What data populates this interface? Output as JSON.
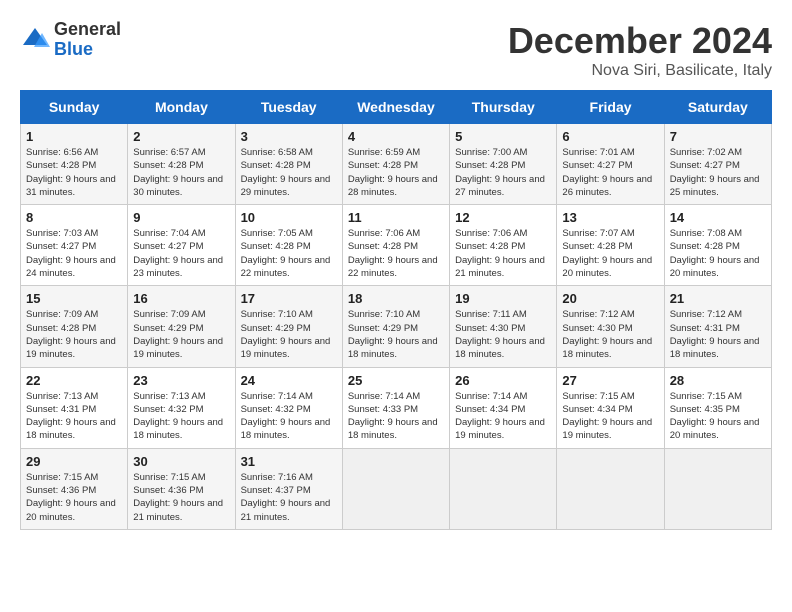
{
  "logo": {
    "general": "General",
    "blue": "Blue"
  },
  "header": {
    "month": "December 2024",
    "location": "Nova Siri, Basilicate, Italy"
  },
  "days_of_week": [
    "Sunday",
    "Monday",
    "Tuesday",
    "Wednesday",
    "Thursday",
    "Friday",
    "Saturday"
  ],
  "weeks": [
    [
      {
        "day": "1",
        "sunrise": "Sunrise: 6:56 AM",
        "sunset": "Sunset: 4:28 PM",
        "daylight": "Daylight: 9 hours and 31 minutes."
      },
      {
        "day": "2",
        "sunrise": "Sunrise: 6:57 AM",
        "sunset": "Sunset: 4:28 PM",
        "daylight": "Daylight: 9 hours and 30 minutes."
      },
      {
        "day": "3",
        "sunrise": "Sunrise: 6:58 AM",
        "sunset": "Sunset: 4:28 PM",
        "daylight": "Daylight: 9 hours and 29 minutes."
      },
      {
        "day": "4",
        "sunrise": "Sunrise: 6:59 AM",
        "sunset": "Sunset: 4:28 PM",
        "daylight": "Daylight: 9 hours and 28 minutes."
      },
      {
        "day": "5",
        "sunrise": "Sunrise: 7:00 AM",
        "sunset": "Sunset: 4:28 PM",
        "daylight": "Daylight: 9 hours and 27 minutes."
      },
      {
        "day": "6",
        "sunrise": "Sunrise: 7:01 AM",
        "sunset": "Sunset: 4:27 PM",
        "daylight": "Daylight: 9 hours and 26 minutes."
      },
      {
        "day": "7",
        "sunrise": "Sunrise: 7:02 AM",
        "sunset": "Sunset: 4:27 PM",
        "daylight": "Daylight: 9 hours and 25 minutes."
      }
    ],
    [
      {
        "day": "8",
        "sunrise": "Sunrise: 7:03 AM",
        "sunset": "Sunset: 4:27 PM",
        "daylight": "Daylight: 9 hours and 24 minutes."
      },
      {
        "day": "9",
        "sunrise": "Sunrise: 7:04 AM",
        "sunset": "Sunset: 4:27 PM",
        "daylight": "Daylight: 9 hours and 23 minutes."
      },
      {
        "day": "10",
        "sunrise": "Sunrise: 7:05 AM",
        "sunset": "Sunset: 4:28 PM",
        "daylight": "Daylight: 9 hours and 22 minutes."
      },
      {
        "day": "11",
        "sunrise": "Sunrise: 7:06 AM",
        "sunset": "Sunset: 4:28 PM",
        "daylight": "Daylight: 9 hours and 22 minutes."
      },
      {
        "day": "12",
        "sunrise": "Sunrise: 7:06 AM",
        "sunset": "Sunset: 4:28 PM",
        "daylight": "Daylight: 9 hours and 21 minutes."
      },
      {
        "day": "13",
        "sunrise": "Sunrise: 7:07 AM",
        "sunset": "Sunset: 4:28 PM",
        "daylight": "Daylight: 9 hours and 20 minutes."
      },
      {
        "day": "14",
        "sunrise": "Sunrise: 7:08 AM",
        "sunset": "Sunset: 4:28 PM",
        "daylight": "Daylight: 9 hours and 20 minutes."
      }
    ],
    [
      {
        "day": "15",
        "sunrise": "Sunrise: 7:09 AM",
        "sunset": "Sunset: 4:28 PM",
        "daylight": "Daylight: 9 hours and 19 minutes."
      },
      {
        "day": "16",
        "sunrise": "Sunrise: 7:09 AM",
        "sunset": "Sunset: 4:29 PM",
        "daylight": "Daylight: 9 hours and 19 minutes."
      },
      {
        "day": "17",
        "sunrise": "Sunrise: 7:10 AM",
        "sunset": "Sunset: 4:29 PM",
        "daylight": "Daylight: 9 hours and 19 minutes."
      },
      {
        "day": "18",
        "sunrise": "Sunrise: 7:10 AM",
        "sunset": "Sunset: 4:29 PM",
        "daylight": "Daylight: 9 hours and 18 minutes."
      },
      {
        "day": "19",
        "sunrise": "Sunrise: 7:11 AM",
        "sunset": "Sunset: 4:30 PM",
        "daylight": "Daylight: 9 hours and 18 minutes."
      },
      {
        "day": "20",
        "sunrise": "Sunrise: 7:12 AM",
        "sunset": "Sunset: 4:30 PM",
        "daylight": "Daylight: 9 hours and 18 minutes."
      },
      {
        "day": "21",
        "sunrise": "Sunrise: 7:12 AM",
        "sunset": "Sunset: 4:31 PM",
        "daylight": "Daylight: 9 hours and 18 minutes."
      }
    ],
    [
      {
        "day": "22",
        "sunrise": "Sunrise: 7:13 AM",
        "sunset": "Sunset: 4:31 PM",
        "daylight": "Daylight: 9 hours and 18 minutes."
      },
      {
        "day": "23",
        "sunrise": "Sunrise: 7:13 AM",
        "sunset": "Sunset: 4:32 PM",
        "daylight": "Daylight: 9 hours and 18 minutes."
      },
      {
        "day": "24",
        "sunrise": "Sunrise: 7:14 AM",
        "sunset": "Sunset: 4:32 PM",
        "daylight": "Daylight: 9 hours and 18 minutes."
      },
      {
        "day": "25",
        "sunrise": "Sunrise: 7:14 AM",
        "sunset": "Sunset: 4:33 PM",
        "daylight": "Daylight: 9 hours and 18 minutes."
      },
      {
        "day": "26",
        "sunrise": "Sunrise: 7:14 AM",
        "sunset": "Sunset: 4:34 PM",
        "daylight": "Daylight: 9 hours and 19 minutes."
      },
      {
        "day": "27",
        "sunrise": "Sunrise: 7:15 AM",
        "sunset": "Sunset: 4:34 PM",
        "daylight": "Daylight: 9 hours and 19 minutes."
      },
      {
        "day": "28",
        "sunrise": "Sunrise: 7:15 AM",
        "sunset": "Sunset: 4:35 PM",
        "daylight": "Daylight: 9 hours and 20 minutes."
      }
    ],
    [
      {
        "day": "29",
        "sunrise": "Sunrise: 7:15 AM",
        "sunset": "Sunset: 4:36 PM",
        "daylight": "Daylight: 9 hours and 20 minutes."
      },
      {
        "day": "30",
        "sunrise": "Sunrise: 7:15 AM",
        "sunset": "Sunset: 4:36 PM",
        "daylight": "Daylight: 9 hours and 21 minutes."
      },
      {
        "day": "31",
        "sunrise": "Sunrise: 7:16 AM",
        "sunset": "Sunset: 4:37 PM",
        "daylight": "Daylight: 9 hours and 21 minutes."
      },
      null,
      null,
      null,
      null
    ]
  ]
}
